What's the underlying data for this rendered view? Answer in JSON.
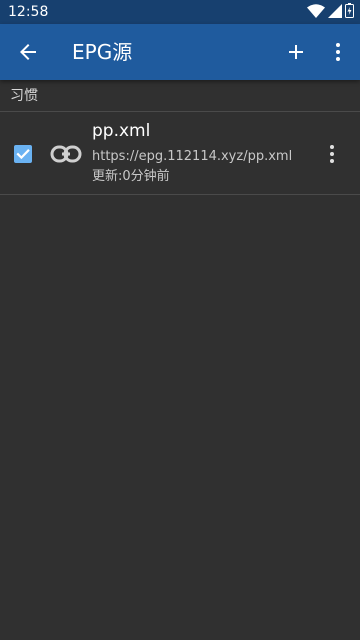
{
  "status_bar": {
    "time": "12:58",
    "icons": [
      "wifi-icon",
      "cell-signal-icon",
      "battery-icon"
    ]
  },
  "app_bar": {
    "title": "EPG源",
    "icons": [
      "back-arrow-icon",
      "add-icon",
      "more-vert-icon"
    ]
  },
  "section": {
    "header": "习惯"
  },
  "sources": [
    {
      "checked": true,
      "icon": "link-icon",
      "name": "pp.xml",
      "url": "https://epg.112114.xyz/pp.xml",
      "updated": "更新:0分钟前"
    }
  ],
  "colors": {
    "status_bar": "#17406f",
    "app_bar": "#1f5b9e",
    "background": "#303030",
    "checkbox": "#6ab2f2",
    "divider": "#4a4a4a"
  }
}
